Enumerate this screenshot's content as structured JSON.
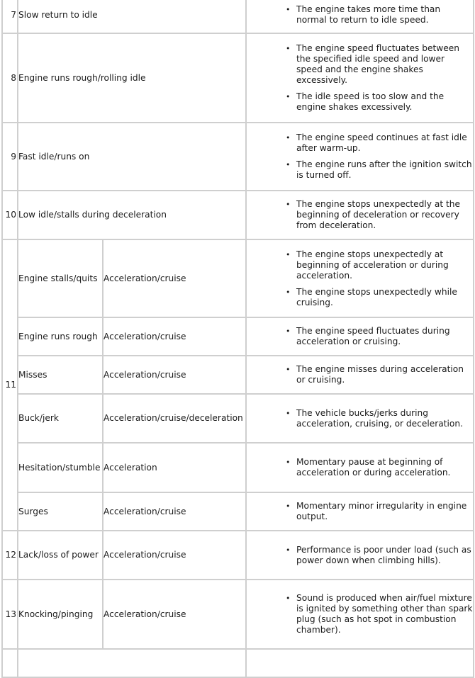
{
  "table": {
    "rows": [
      {
        "number": "7",
        "symptom": "Slow return to idle",
        "condition": "",
        "descriptions": [
          "The engine takes more time than normal to return to idle speed."
        ]
      },
      {
        "number": "8",
        "symptom": "Engine runs rough/rolling idle",
        "condition": "",
        "descriptions": [
          "The engine speed fluctuates between the specified idle speed and lower speed and the engine shakes excessively.",
          "The idle speed is too slow and the engine shakes excessively."
        ]
      },
      {
        "number": "9",
        "symptom": "Fast idle/runs on",
        "condition": "",
        "descriptions": [
          "The engine speed continues at fast idle after warm-up.",
          "The engine runs after the ignition switch is turned off."
        ]
      },
      {
        "number": "10",
        "symptom": "Low idle/stalls during deceleration",
        "condition": "",
        "descriptions": [
          "The engine stops unexpectedly at the beginning of deceleration or recovery from deceleration."
        ]
      }
    ],
    "group11": {
      "number": "11",
      "subrows": [
        {
          "symptom": "Engine stalls/quits",
          "condition": "Acceleration/cruise",
          "descriptions": [
            "The engine stops unexpectedly at beginning of acceleration or during acceleration.",
            "The engine stops unexpectedly while cruising."
          ]
        },
        {
          "symptom": "Engine runs rough",
          "condition": "Acceleration/cruise",
          "descriptions": [
            "The engine speed fluctuates during acceleration or cruising."
          ]
        },
        {
          "symptom": "Misses",
          "condition": "Acceleration/cruise",
          "descriptions": [
            "The engine misses during acceleration or cruising."
          ]
        },
        {
          "symptom": "Buck/jerk",
          "condition": "Acceleration/cruise/deceleration",
          "descriptions": [
            "The vehicle bucks/jerks during acceleration, cruising, or deceleration."
          ]
        },
        {
          "symptom": "Hesitation/stumble",
          "condition": "Acceleration",
          "descriptions": [
            "Momentary pause at beginning of acceleration or during acceleration."
          ]
        },
        {
          "symptom": "Surges",
          "condition": "Acceleration/cruise",
          "descriptions": [
            "Momentary minor irregularity in engine output."
          ]
        }
      ]
    },
    "rows_after": [
      {
        "number": "12",
        "symptom": "Lack/loss of power",
        "condition": "Acceleration/cruise",
        "descriptions": [
          "Performance is poor under load (such as power down when climbing hills)."
        ]
      },
      {
        "number": "13",
        "symptom": "Knocking/pinging",
        "condition": "Acceleration/cruise",
        "descriptions": [
          "Sound is produced when air/fuel mixture is ignited by something other than spark plug (such as hot spot in combustion chamber)."
        ]
      }
    ]
  }
}
